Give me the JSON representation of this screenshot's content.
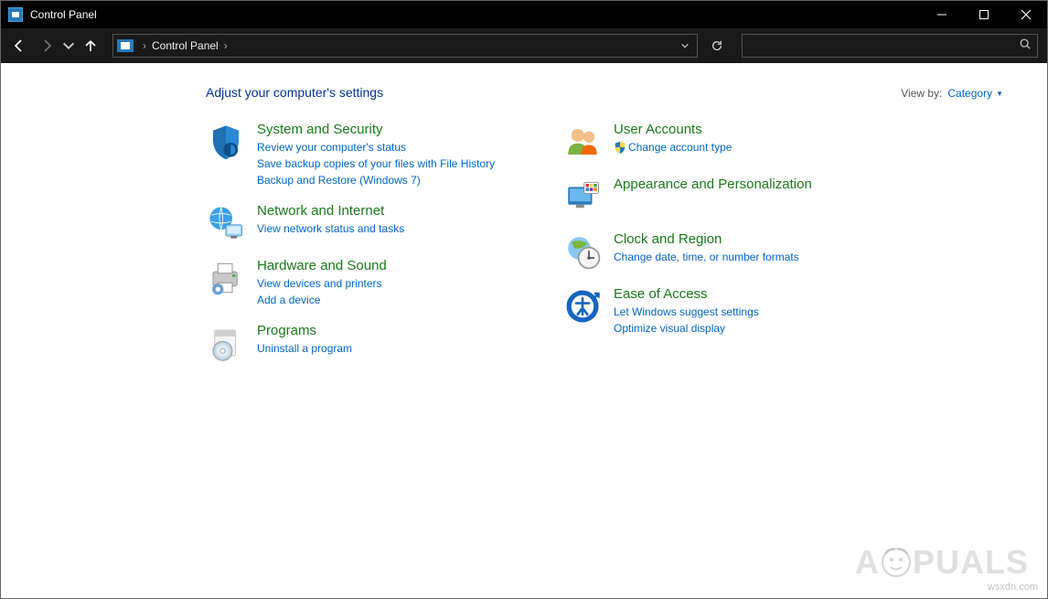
{
  "titlebar": {
    "title": "Control Panel"
  },
  "address": {
    "crumb": "Control Panel"
  },
  "search": {
    "placeholder": ""
  },
  "header": {
    "heading": "Adjust your computer's settings"
  },
  "viewby": {
    "label": "View by:",
    "value": "Category"
  },
  "left": {
    "system": {
      "title": "System and Security",
      "l1": "Review your computer's status",
      "l2": "Save backup copies of your files with File History",
      "l3": "Backup and Restore (Windows 7)"
    },
    "network": {
      "title": "Network and Internet",
      "l1": "View network status and tasks"
    },
    "hardware": {
      "title": "Hardware and Sound",
      "l1": "View devices and printers",
      "l2": "Add a device"
    },
    "programs": {
      "title": "Programs",
      "l1": "Uninstall a program"
    }
  },
  "right": {
    "users": {
      "title": "User Accounts",
      "l1": "Change account type"
    },
    "appearance": {
      "title": "Appearance and Personalization"
    },
    "clock": {
      "title": "Clock and Region",
      "l1": "Change date, time, or number formats"
    },
    "ease": {
      "title": "Ease of Access",
      "l1": "Let Windows suggest settings",
      "l2": "Optimize visual display"
    }
  },
  "watermark": "wsxdn.com",
  "logo_a": "A",
  "logo_b": "PUALS"
}
